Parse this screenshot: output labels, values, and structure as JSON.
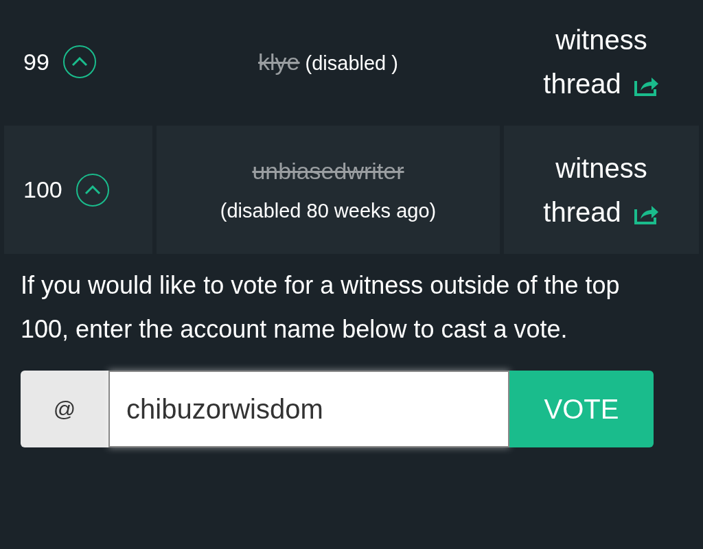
{
  "witnesses": [
    {
      "rank": "99",
      "name": "klye",
      "disabled": true,
      "note": "(disabled )",
      "kind": "inline",
      "link": "witness thread"
    },
    {
      "rank": "100",
      "name": "unbiasedwriter",
      "disabled": true,
      "note": "(disabled 80 weeks ago)",
      "kind": "stacked",
      "link": "witness thread"
    }
  ],
  "info": "If you would like to vote for a witness outside of the top 100, enter the account name below to cast a vote.",
  "vote_form": {
    "prefix": "@",
    "value": "chibuzorwisdom",
    "button": "VOTE"
  }
}
